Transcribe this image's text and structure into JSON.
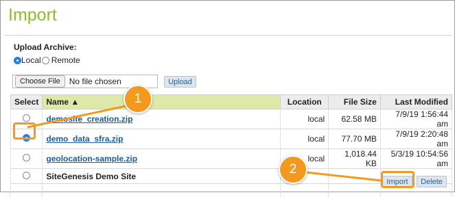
{
  "page": {
    "title": "Import"
  },
  "upload": {
    "label": "Upload Archive:",
    "options": [
      {
        "label": "Local",
        "selected": true
      },
      {
        "label": "Remote",
        "selected": false
      }
    ],
    "choose_file_label": "Choose File",
    "no_file_text": "No file chosen",
    "upload_button": "Upload"
  },
  "table": {
    "columns": [
      "Select",
      "Name ▲",
      "Location",
      "File Size",
      "Last Modified"
    ],
    "rows": [
      {
        "name": "demosite_creation.zip",
        "location": "local",
        "size": "62.58 MB",
        "modified": "7/9/19 1:56:44 am",
        "selected": false,
        "link": true
      },
      {
        "name": "demo_data_sfra.zip",
        "location": "local",
        "size": "77.70 MB",
        "modified": "7/9/19 2:20:48 am",
        "selected": true,
        "link": true
      },
      {
        "name": "geolocation-sample.zip",
        "location": "local",
        "size": "1,018.44 KB",
        "modified": "5/3/19 10:54:56 am",
        "selected": false,
        "link": true
      },
      {
        "name": "SiteGenesis Demo Site",
        "location": "",
        "size": "",
        "modified": "",
        "selected": false,
        "link": false
      }
    ]
  },
  "actions": {
    "import": "Import",
    "delete": "Delete"
  },
  "callouts": {
    "one": "1",
    "two": "2"
  },
  "colors": {
    "title": "#8cbf26",
    "callout": "#f39a1e",
    "link": "#1a5a9e",
    "name_header": "#dde9a9"
  }
}
